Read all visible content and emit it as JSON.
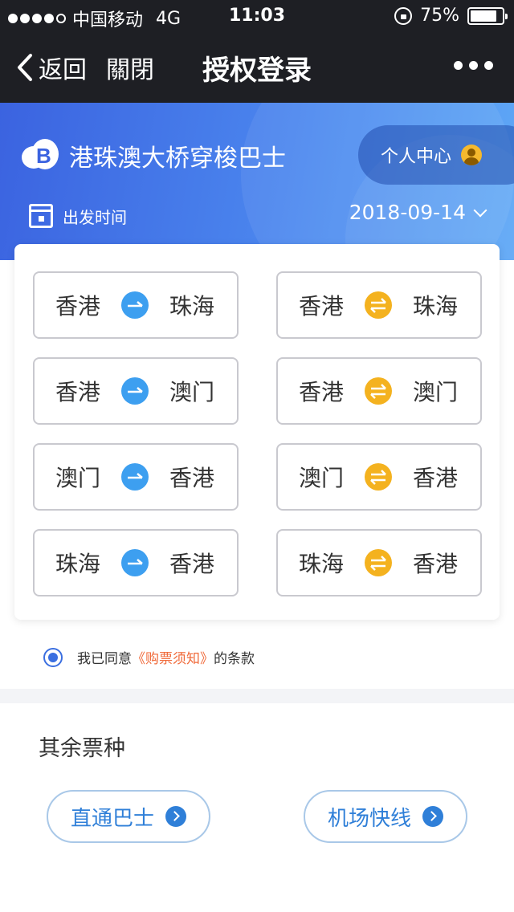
{
  "status_bar": {
    "carrier": "中国移动",
    "network": "4G",
    "time": "11:03",
    "battery": "75%",
    "battery_level": 0.75
  },
  "nav": {
    "back_label": "返回",
    "close_label": "關閉",
    "title": "授权登录"
  },
  "banner": {
    "brand_name": "港珠澳大桥穿梭巴士",
    "user_center_label": "个人中心",
    "depart_label": "出发时间",
    "depart_date": "2018-09-14"
  },
  "routes": [
    {
      "from": "香港",
      "to": "珠海",
      "type": "oneway"
    },
    {
      "from": "香港",
      "to": "珠海",
      "type": "roundtrip"
    },
    {
      "from": "香港",
      "to": "澳门",
      "type": "oneway"
    },
    {
      "from": "香港",
      "to": "澳门",
      "type": "roundtrip"
    },
    {
      "from": "澳门",
      "to": "香港",
      "type": "oneway"
    },
    {
      "from": "澳门",
      "to": "香港",
      "type": "roundtrip"
    },
    {
      "from": "珠海",
      "to": "香港",
      "type": "oneway"
    },
    {
      "from": "珠海",
      "to": "香港",
      "type": "roundtrip"
    }
  ],
  "agreement": {
    "prefix": "我已同意",
    "link": "《购票须知》",
    "suffix": "的条款"
  },
  "other": {
    "title": "其余票种",
    "buttons": [
      "直通巴士",
      "机场快线"
    ]
  },
  "colors": {
    "oneway": "#3d9ff0",
    "roundtrip": "#f4b21f",
    "terms_link": "#f06a3a",
    "accent": "#2f7fd8"
  }
}
